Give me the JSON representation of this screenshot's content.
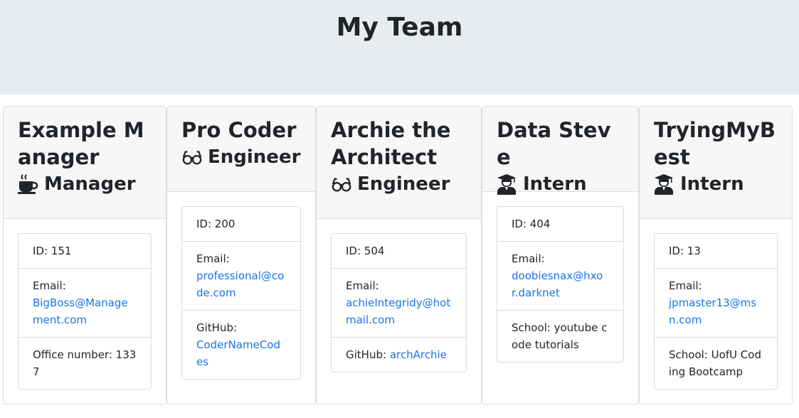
{
  "page_title": "My Team",
  "colors": {
    "link": "#1a73e8",
    "header_bg": "#e9ecef",
    "card_header_bg": "#f7f7f7"
  },
  "cards": [
    {
      "name": "Example Manager",
      "role": "Manager",
      "role_icon": "mug-hot-icon",
      "id_text": "ID: 151",
      "email_label": "Email:",
      "email": "BigBoss@Management.com",
      "extra_label": "Office number: 1337",
      "extra_link": ""
    },
    {
      "name": "Pro Coder",
      "role": "Engineer",
      "role_icon": "glasses-icon",
      "id_text": "ID: 200",
      "email_label": "Email:",
      "email": "professional@code.com",
      "extra_label": "GitHub:",
      "extra_link": "CoderNameCodes"
    },
    {
      "name": "Archie the Architect",
      "role": "Engineer",
      "role_icon": "glasses-icon",
      "id_text": "ID: 504",
      "email_label": "Email:",
      "email": "achieIntegridy@hotmail.com",
      "extra_label": "GitHub:",
      "extra_link": "archArchie"
    },
    {
      "name": "Data Steve",
      "role": "Intern",
      "role_icon": "user-graduate-icon",
      "id_text": "ID: 404",
      "email_label": "Email:",
      "email": "doobiesnax@hxor.darknet",
      "extra_label": "School: youtube code tutorials",
      "extra_link": ""
    },
    {
      "name": "TryingMyBest",
      "role": "Intern",
      "role_icon": "user-graduate-icon",
      "id_text": "ID: 13",
      "email_label": "Email:",
      "email": "jpmaster13@msn.com",
      "extra_label": "School: UofU Coding Bootcamp",
      "extra_link": ""
    }
  ]
}
